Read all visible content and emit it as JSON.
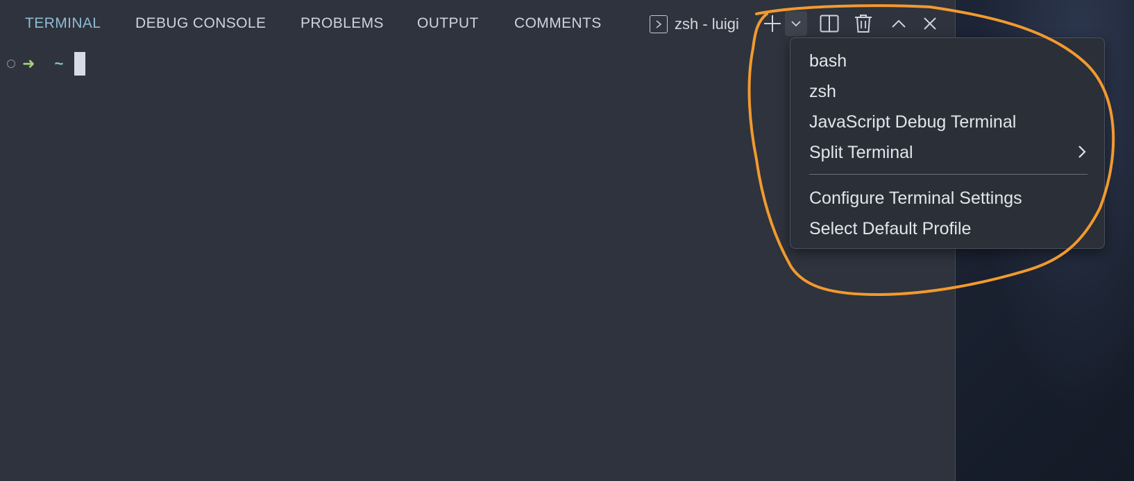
{
  "tabs": [
    {
      "label": "TERMINAL",
      "active": true
    },
    {
      "label": "DEBUG CONSOLE",
      "active": false
    },
    {
      "label": "PROBLEMS",
      "active": false
    },
    {
      "label": "OUTPUT",
      "active": false
    },
    {
      "label": "COMMENTS",
      "active": false
    }
  ],
  "terminal": {
    "name": "zsh - luigi",
    "prompt_symbol": "➜",
    "cwd": "~"
  },
  "toolbar_icons": [
    "new-terminal-plus-icon",
    "chevron-down-icon",
    "split-terminal-icon",
    "trash-icon",
    "chevron-up-icon",
    "close-icon"
  ],
  "menu": {
    "items": [
      {
        "label": "bash"
      },
      {
        "label": "zsh"
      },
      {
        "label": "JavaScript Debug Terminal"
      },
      {
        "label": "Split Terminal",
        "submenu": true
      },
      {
        "label": "Configure Terminal Settings"
      },
      {
        "label": "Select Default Profile"
      }
    ]
  },
  "colors": {
    "panel_bg": "#2f333d",
    "active_tab": "#8fbcd4",
    "prompt_arrow": "#a5d17a",
    "prompt_cwd": "#7fc8d6",
    "annotation": "#f29a2e"
  }
}
